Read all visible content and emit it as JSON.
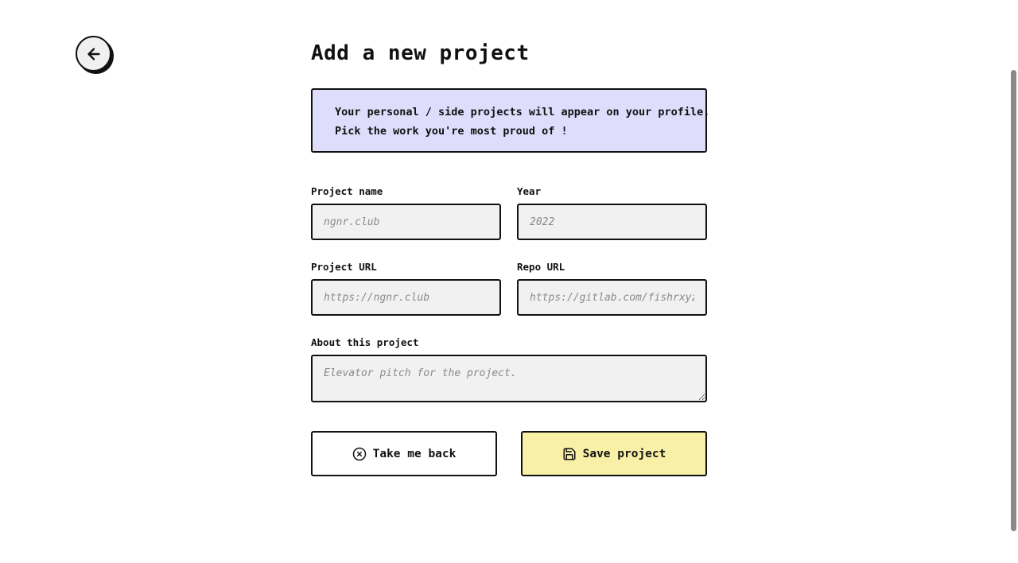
{
  "back_nav": {
    "icon": "arrow-left-icon"
  },
  "page": {
    "title": "Add a new project"
  },
  "info": {
    "line1": "Your personal / side projects will appear on your profile.",
    "line2": "Pick the work you're most proud of !"
  },
  "form": {
    "project_name": {
      "label": "Project name",
      "placeholder": "ngnr.club",
      "value": ""
    },
    "year": {
      "label": "Year",
      "placeholder": "2022",
      "value": ""
    },
    "project_url": {
      "label": "Project URL",
      "placeholder": "https://ngnr.club",
      "value": ""
    },
    "repo_url": {
      "label": "Repo URL",
      "placeholder": "https://gitlab.com/fishrxyz/ngnr",
      "value": ""
    },
    "about": {
      "label": "About this project",
      "placeholder": "Elevator pitch for the project.",
      "value": ""
    }
  },
  "actions": {
    "cancel_label": "Take me back",
    "cancel_icon": "x-circle-icon",
    "save_label": "Save project",
    "save_icon": "floppy-disk-icon",
    "save_color": "#f8f0a6"
  },
  "colors": {
    "info_bg": "#dedefc",
    "input_bg": "#f1f1f1",
    "border": "#111111"
  }
}
